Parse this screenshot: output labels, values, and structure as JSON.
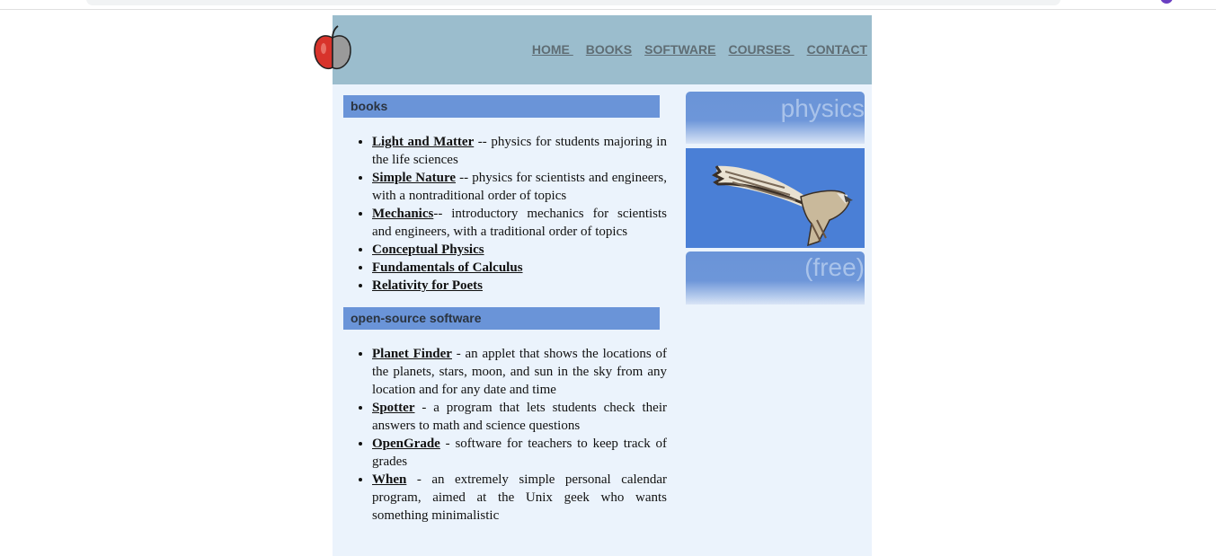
{
  "nav": {
    "home": "HOME ",
    "books": "BOOKS",
    "software": "SOFTWARE",
    "courses": "COURSES ",
    "contact": "CONTACT"
  },
  "sections": {
    "books": {
      "title": "books",
      "items": [
        {
          "link": "Light and Matter",
          "desc": " -- physics for students majoring in the life sciences"
        },
        {
          "link": "Simple Nature",
          "desc": " -- physics for scientists and engineers, with a nontraditional order of topics"
        },
        {
          "link": "Mechanics",
          "desc": "-- introductory mechanics for scientists and engineers, with a traditional order of topics"
        },
        {
          "link": "Conceptual Physics",
          "desc": ""
        },
        {
          "link": "Fundamentals of Calculus",
          "desc": ""
        },
        {
          "link": "Relativity for Poets",
          "desc": ""
        }
      ]
    },
    "software": {
      "title": "open-source software",
      "items": [
        {
          "link": "Planet Finder",
          "desc": " - an applet that shows the locations of the planets, stars, moon, and sun in the sky from any location and for any date and time"
        },
        {
          "link": "Spotter",
          "desc": " - a program that lets students check their answers to math and science questions"
        },
        {
          "link": "OpenGrade",
          "desc": " - software for teachers to keep track of grades"
        },
        {
          "link": "When",
          "desc": " - an extremely simple personal calendar program, aimed at the Unix geek who wants something minimalistic"
        }
      ]
    }
  },
  "sidebar": {
    "top_text": "physics",
    "bottom_text": "(free)",
    "photo_icon": "hawk-icon"
  },
  "logo_icon": "apple-icon",
  "colors": {
    "header_bg": "#9bbdcd",
    "section_bg": "#6a94d8",
    "page_bg": "#ebf3fc"
  }
}
